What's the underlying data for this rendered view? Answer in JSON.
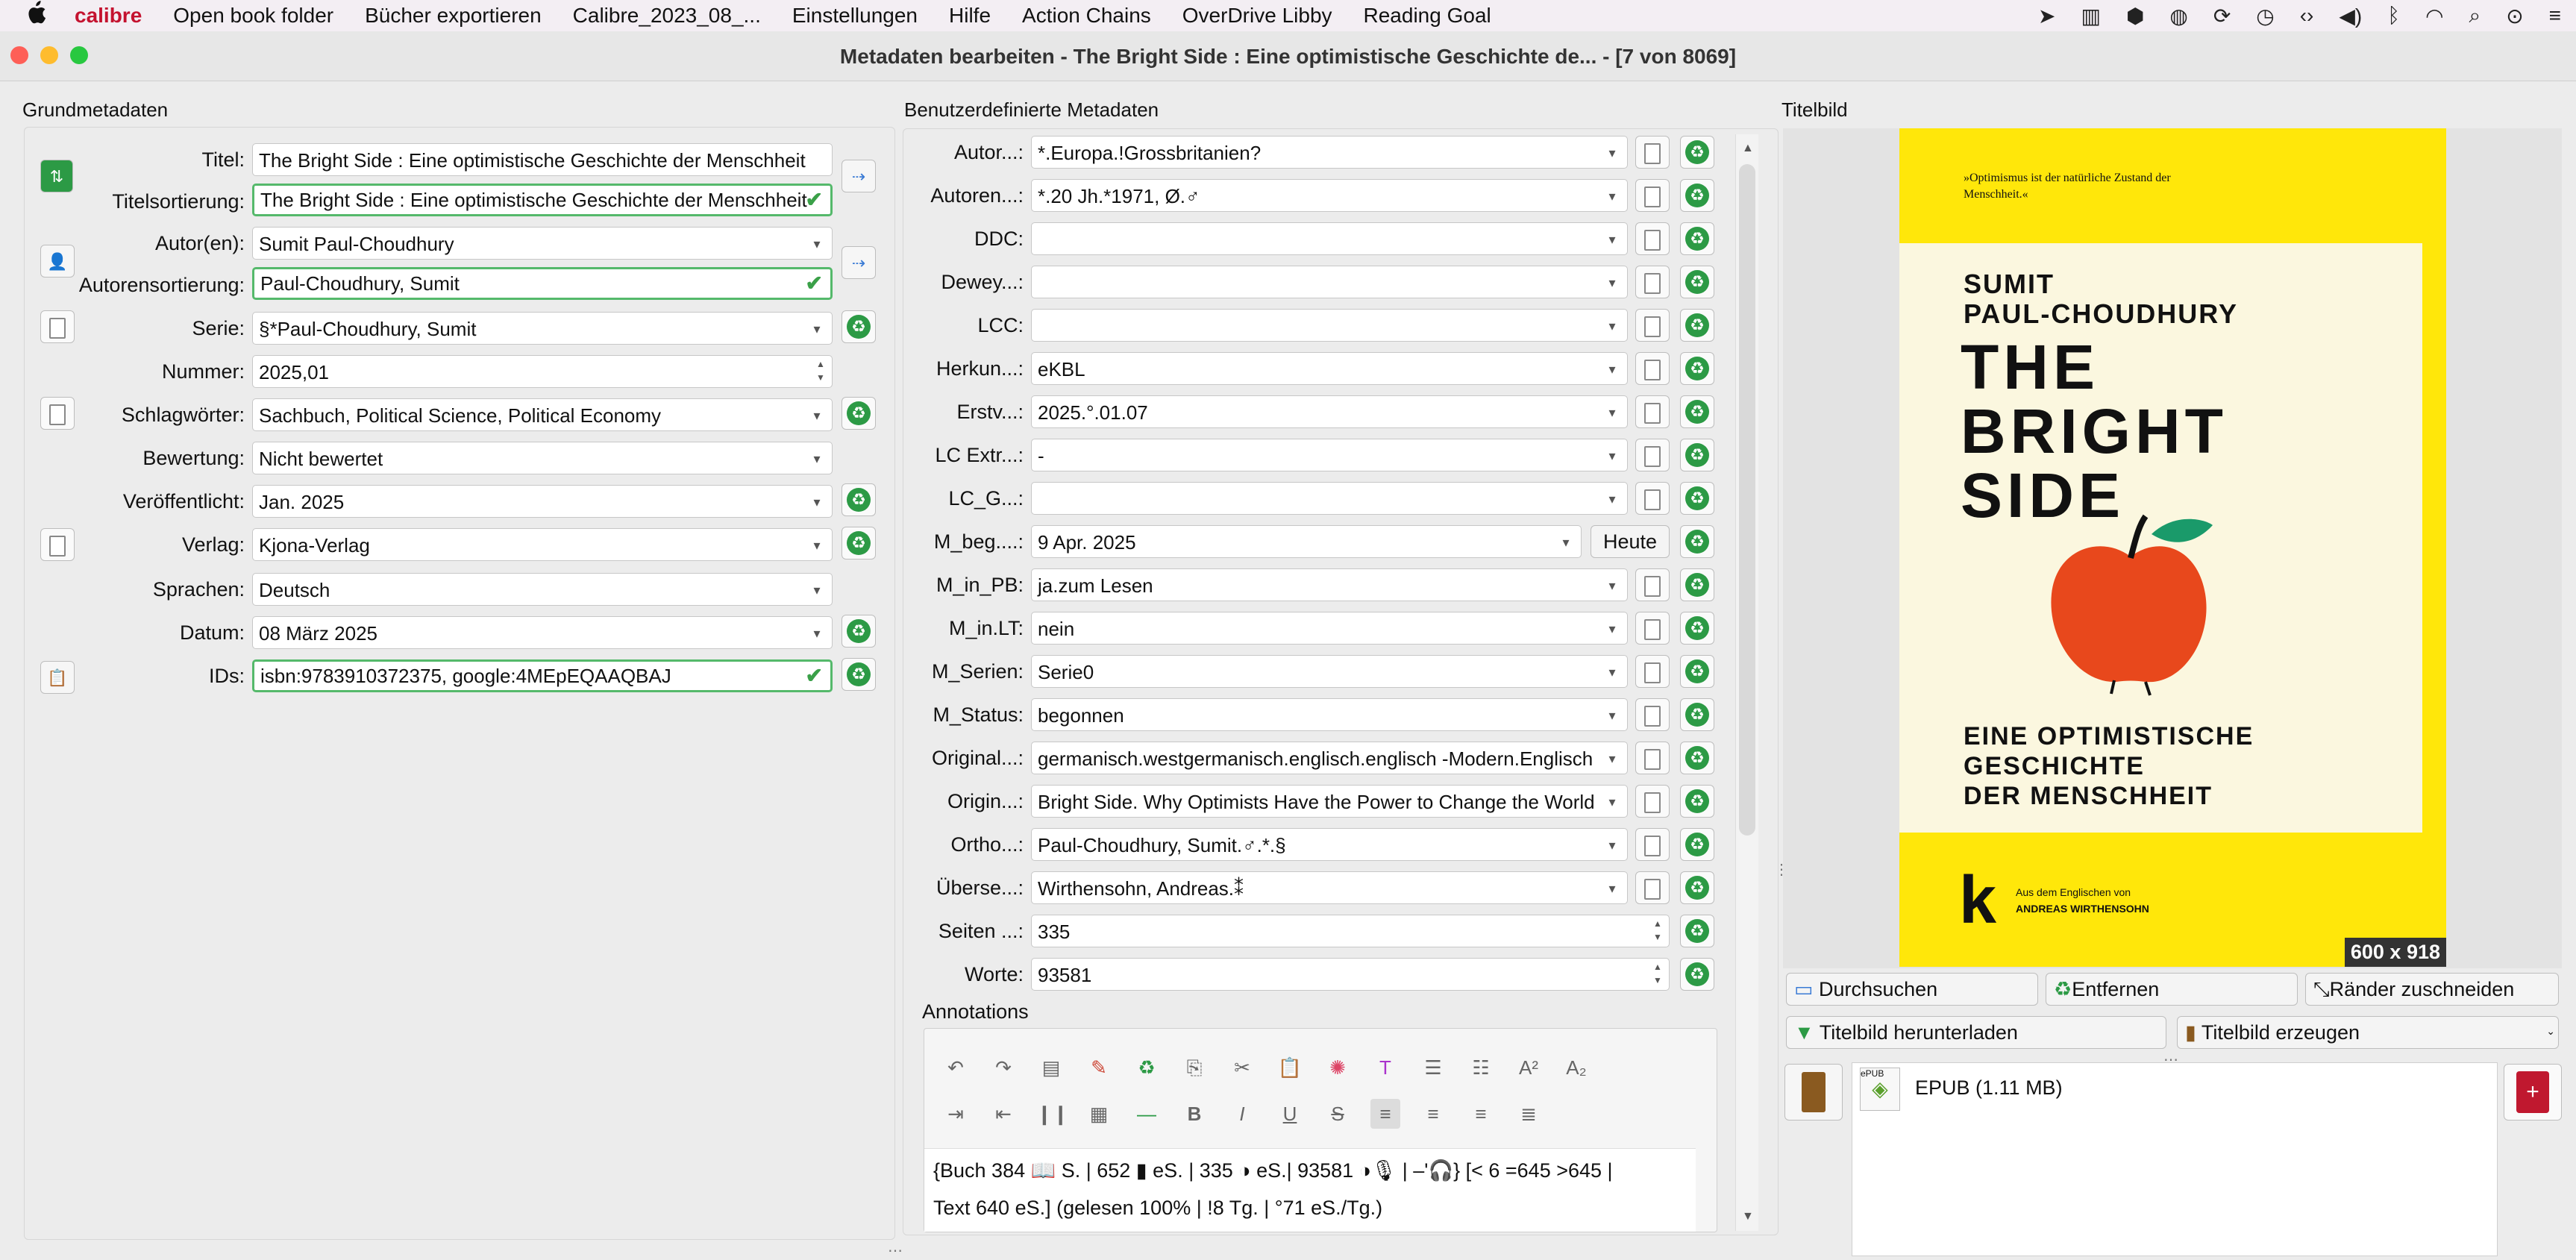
{
  "menubar": {
    "app": "calibre",
    "items": [
      "Open book folder",
      "Bücher exportieren",
      "Calibre_2023_08_...",
      "Einstellungen",
      "Hilfe",
      "Action Chains",
      "OverDrive Libby",
      "Reading Goal"
    ]
  },
  "window": {
    "title": "Metadaten bearbeiten - The Bright Side : Eine optimistische Geschichte de... -  [7 von 8069]"
  },
  "basic": {
    "heading": "Grundmetadaten",
    "title_label": "Titel:",
    "title_value": "The Bright Side : Eine optimistische Geschichte der Menschheit",
    "title_sort_label": "Titelsortierung:",
    "title_sort_value": "The Bright Side : Eine optimistische Geschichte der Menschheit",
    "authors_label": "Autor(en):",
    "authors_value": "Sumit Paul-Choudhury",
    "author_sort_label": "Autorensortierung:",
    "author_sort_value": "Paul-Choudhury, Sumit",
    "series_label": "Serie:",
    "series_value": "§*Paul-Choudhury, Sumit",
    "number_label": "Nummer:",
    "number_value": "2025,01",
    "tags_label": "Schlagwörter:",
    "tags_value": "Sachbuch, Political Science, Political Economy",
    "rating_label": "Bewertung:",
    "rating_value": "Nicht bewertet",
    "published_label": "Veröffentlicht:",
    "published_value": "Jan. 2025",
    "publisher_label": "Verlag:",
    "publisher_value": "Kjona-Verlag",
    "languages_label": "Sprachen:",
    "languages_value": "Deutsch",
    "date_label": "Datum:",
    "date_value": "08 März 2025",
    "ids_label": "IDs:",
    "ids_value": "isbn:9783910372375, google:4MEpEQAAQBAJ"
  },
  "custom": {
    "heading": "Benutzerdefinierte Metadaten",
    "rows": [
      {
        "label": "Autor...:",
        "value": "*.Europa.!Grossbritanien?"
      },
      {
        "label": "Autoren...:",
        "value": "*.20 Jh.*1971, Ø.♂"
      },
      {
        "label": "DDC:",
        "value": ""
      },
      {
        "label": "Dewey...:",
        "value": ""
      },
      {
        "label": "LCC:",
        "value": ""
      },
      {
        "label": "Herkun...:",
        "value": "eKBL"
      },
      {
        "label": "Erstv...:",
        "value": "2025.°.01.07"
      },
      {
        "label": "LC Extr...:",
        "value": "-"
      },
      {
        "label": "LC_G...:",
        "value": ""
      },
      {
        "label": "M_beg....:",
        "value": "9 Apr. 2025"
      },
      {
        "label": "M_in_PB:",
        "value": "ja.zum Lesen"
      },
      {
        "label": "M_in.LT:",
        "value": "nein"
      },
      {
        "label": "M_Serien:",
        "value": "Serie0"
      },
      {
        "label": "M_Status:",
        "value": "begonnen"
      },
      {
        "label": "Original...:",
        "value": "germanisch.westgermanisch.englisch.englisch -Modern.Englisch"
      },
      {
        "label": "Origin...:",
        "value": "Bright Side. Why Optimists Have the Power to Change the World"
      },
      {
        "label": "Ortho...:",
        "value": "Paul-Choudhury, Sumit.♂.*.§"
      },
      {
        "label": "Überse...:",
        "value": "Wirthensohn, Andreas.⁑"
      },
      {
        "label": "Seiten ...:",
        "value": "335"
      },
      {
        "label": "Worte:",
        "value": "93581"
      }
    ],
    "today_button": "Heute",
    "annotations_label": "Annotations",
    "annotation_line1": "{Buch 384 📖 S. | 652 ▮ eS. | 335 ◑ eS.| 93581 ◑🎙 | –'🎧} [< 6 =645 >645 |",
    "annotation_line2": "Text 640 eS.] (gelesen 100% | !8 Tg. | °71 eS./Tg.)"
  },
  "cover_panel": {
    "heading": "Titelbild",
    "cover_quote": "»Optimismus ist der natürliche Zustand der Menschheit.«",
    "cover_author1": "SUMIT",
    "cover_author2": "PAUL-CHOUDHURY",
    "cover_title1": "THE",
    "cover_title2": "BRIGHT",
    "cover_title3": "SIDE",
    "cover_subtitle1": "EINE OPTIMISTISCHE",
    "cover_subtitle2": "GESCHICHTE",
    "cover_subtitle3": "DER MENSCHHEIT",
    "cover_translator_line1": "Aus dem Englischen von",
    "cover_translator_line2": "ANDREAS WIRTHENSOHN",
    "size_badge": "600 x 918",
    "browse_button": "Durchsuchen",
    "remove_button": "Entfernen",
    "trim_button": "Ränder zuschneiden",
    "download_button": "Titelbild herunterladen",
    "generate_button": "Titelbild erzeugen",
    "format_label": "EPUB (1.11 MB)",
    "format_icon_text": "ePUB"
  },
  "colors": {
    "accent_green": "#2c9a45",
    "cover_yellow": "#ffe70a",
    "apple_red": "#e8481c"
  }
}
